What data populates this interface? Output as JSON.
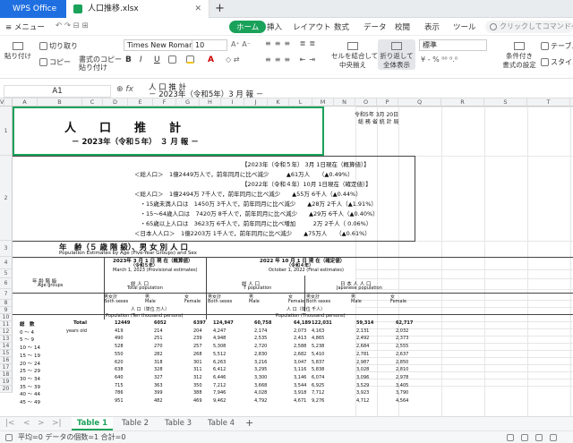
{
  "tabs": {
    "app": "WPS Office",
    "doc": "人口推移.xlsx",
    "close": "✕",
    "new": "+"
  },
  "menu": {
    "main_menu": "≡ メニュー",
    "items": [
      "ホーム",
      "挿入",
      "レイアウト",
      "数式",
      "データ",
      "校閲",
      "表示",
      "ツール"
    ],
    "search_placeholder": "クリックしてコマンドを"
  },
  "ribbon": {
    "paste": "貼り付け",
    "cut": "切り取り",
    "copy": "コピー",
    "format_painter": "書式のコピー\n貼り付け",
    "font_name": "Times New Roman",
    "font_size": "10",
    "bold": "B",
    "italic": "I",
    "underline": "U",
    "font_color": "A",
    "merge": "セルを結合して\n中央揃え",
    "wrap": "折り返して\n全体表示",
    "number_format": "標準",
    "conditional": "条件付き\n書式の設定",
    "table": "テーブル",
    "style": "スタイル"
  },
  "formula_bar": {
    "cell_ref": "A1",
    "zoom_icon": "⊕",
    "fx": "fx",
    "content": "人 口 推 計\n－ 2023年（令和5年）3 月 報 －"
  },
  "columns": [
    "A",
    "B",
    "C",
    "D",
    "E",
    "F",
    "G",
    "H",
    "I",
    "J",
    "K",
    "L",
    "M",
    "N",
    "O",
    "P",
    "Q",
    "R",
    "S",
    "T",
    "U",
    "V"
  ],
  "rows": [
    "1",
    "2",
    "3",
    "4",
    "5",
    "6",
    "7",
    "8",
    "9",
    "10",
    "11",
    "12",
    "13",
    "14",
    "15",
    "16",
    "17",
    "18",
    "19",
    "20"
  ],
  "sheet": {
    "header_right": [
      "令和5年 3月 20日",
      "総 務 省 統 計 局"
    ],
    "title": "人　　口　　推　　計",
    "subtitle": "－ 2023年（令和５年）　３ 月 報 －",
    "summary": [
      "【2023年（令和５年） 3月 1日現在（概算値）】",
      "＜総人口＞　1億2449万人で，前年同月に比べ減少　　　▲61万人　　（▲0.49%）",
      "【2022年（令和４年）10月 1日現在（確定値）】",
      "＜総人口＞　1億2494万 7千人で，前年同月に比べ減少　　▲55万 6千人（▲0.44%）",
      "　・15歳未満人口は　1450万 3千人で，前年同月に比べ減少　　▲28万 2千人（▲1.91%）",
      "　・15～64歳人口は　7420万 8千人で，前年同月に比べ減少　　▲29万 6千人（▲0.40%）",
      "　・65歳以上人口は　3623万 6千人で，前年同月に比べ増加　　　2万 2千人（ 0.06%）",
      "＜日本人人口＞　1億2203万 1千人で，前年同月に比べ減少　　▲75万人　　（▲0.61%）"
    ],
    "table_title": "年　齢（５ 歳 階 級）、男 女 別 人 口",
    "table_title_en": "Population Estimates by Age (Five-Year Groups) and Sex",
    "hdr_2023": "2023年 3 月 1 日 現 在（概算値）",
    "hdr_2023_sub": "（令和５年）",
    "hdr_2023_en": "March 1, 2023 (Provisional estimates)",
    "hdr_2022": "2022 年 10 月 1 日 現 在（確定値）",
    "hdr_2022_sub": "（令和４年）",
    "hdr_2022_en": "October 1, 2022 (Final estimates)",
    "age_label": "年 齢 階 級",
    "age_label_en": "Age groups",
    "total_pop": "総 人 口",
    "total_pop_en": "Total population",
    "total_pop2": "総 人 口",
    "total_pop2_en": "T population",
    "japanese_pop": "日 本 人 人 口",
    "japanese_pop_en": "Japanese population",
    "sex_cols": [
      "男女計",
      "Both sexes",
      "男",
      "Male",
      "女",
      "Female"
    ],
    "unit_1": "人 口（単位 万人）",
    "unit_1_en": "Population (Ten thousand persons)",
    "unit_2": "人 口（単位 千人）",
    "unit_2_en": "Population (Thousand persons)",
    "total_label": "総　　数",
    "total_label_en": "Total",
    "years_old": "years old",
    "data_rows": [
      [
        "総　数",
        "Total",
        "12449",
        "6052",
        "6397",
        "124,947",
        "60,758",
        "64,189",
        "122,031",
        "59,314",
        "62,717"
      ],
      [
        "0 ～ 4",
        "",
        "419",
        "214",
        "204",
        "4,247",
        "2,174",
        "2,073",
        "4,163",
        "2,131",
        "2,032"
      ],
      [
        "5 ～ 9",
        "",
        "490",
        "251",
        "239",
        "4,948",
        "2,535",
        "2,413",
        "4,865",
        "2,492",
        "2,373"
      ],
      [
        "10 ～ 14",
        "",
        "528",
        "270",
        "257",
        "5,308",
        "2,720",
        "2,588",
        "5,238",
        "2,684",
        "2,555"
      ],
      [
        "15 ～ 19",
        "",
        "550",
        "282",
        "268",
        "5,512",
        "2,830",
        "2,682",
        "5,410",
        "2,781",
        "2,637"
      ],
      [
        "20 ～ 24",
        "",
        "620",
        "318",
        "301",
        "6,263",
        "3,216",
        "3,047",
        "5,837",
        "2,987",
        "2,850"
      ],
      [
        "25 ～ 29",
        "",
        "638",
        "328",
        "311",
        "6,412",
        "3,295",
        "3,116",
        "5,838",
        "3,028",
        "2,810"
      ],
      [
        "30 ～ 34",
        "",
        "640",
        "327",
        "312",
        "6,446",
        "3,300",
        "3,146",
        "6,074",
        "3,096",
        "2,978"
      ],
      [
        "35 ～ 39",
        "",
        "715",
        "363",
        "350",
        "7,212",
        "3,668",
        "3,544",
        "6,925",
        "3,529",
        "3,405"
      ],
      [
        "40 ～ 44",
        "",
        "786",
        "399",
        "388",
        "7,946",
        "4,028",
        "3,918",
        "7,712",
        "3,923",
        "3,790"
      ],
      [
        "45 ～ 49",
        "",
        "951",
        "482",
        "469",
        "9,462",
        "4,792",
        "4,671",
        "9,276",
        "4,712",
        "4,564"
      ]
    ]
  },
  "sheets": [
    "Table 1",
    "Table 2",
    "Table 3",
    "Table 4"
  ],
  "status": {
    "text": "平均=0  データの個数=1  合計=0"
  }
}
